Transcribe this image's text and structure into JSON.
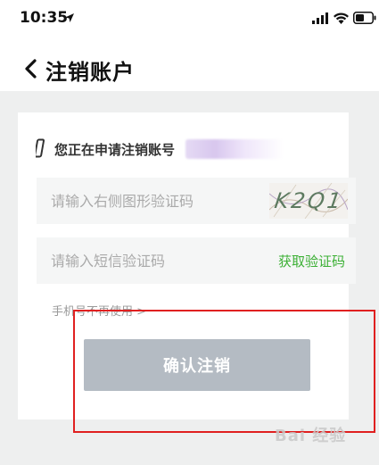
{
  "status_bar": {
    "time": "10:35",
    "icons": [
      "location-arrow-icon",
      "signal-icon",
      "wifi-icon",
      "battery-icon"
    ]
  },
  "nav": {
    "back_icon": "chevron-left-icon",
    "title": "注销账户"
  },
  "account": {
    "label": "您正在申请注销账号"
  },
  "form": {
    "captcha_placeholder": "请输入右侧图形验证码",
    "captcha_image_text": "K2Q1",
    "sms_placeholder": "请输入短信验证码",
    "get_code_label": "获取验证码",
    "phone_unused_label": "手机号不再使用 >",
    "confirm_label": "确认注销"
  },
  "colors": {
    "accent_green": "#3cb035",
    "button_disabled": "#b4bbc3",
    "highlight_red": "#e02020"
  },
  "watermark": "Bai 经验"
}
